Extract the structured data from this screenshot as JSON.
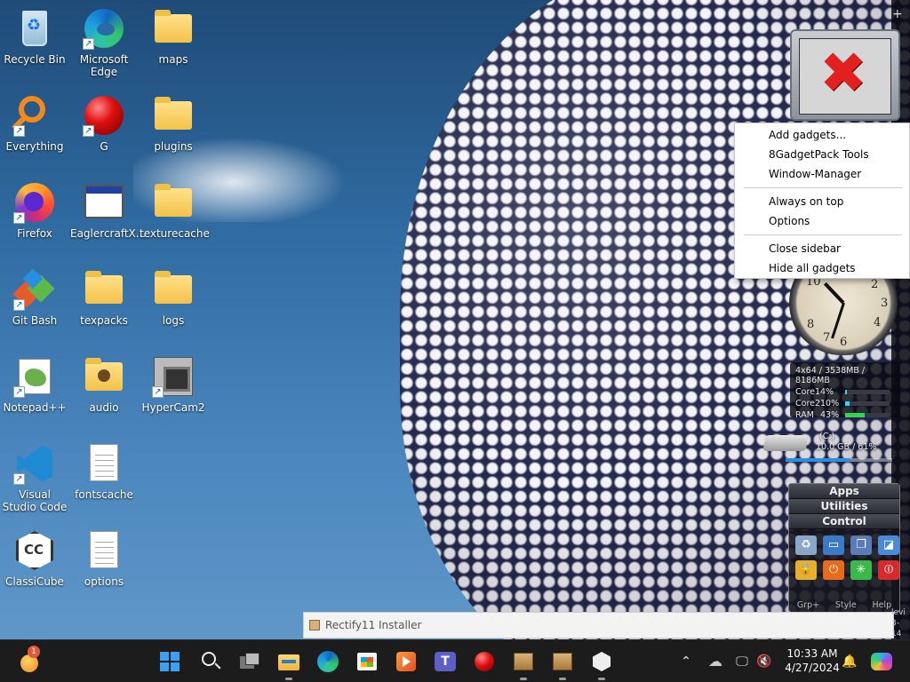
{
  "desktop": {
    "icons": [
      {
        "label": "Recycle Bin",
        "icon": "recycle-bin-icon"
      },
      {
        "label": "Microsoft Edge",
        "icon": "edge-icon"
      },
      {
        "label": "maps",
        "icon": "folder-icon"
      },
      {
        "label": "Everything",
        "icon": "magnifier-icon"
      },
      {
        "label": "G",
        "icon": "red-ball-icon"
      },
      {
        "label": "plugins",
        "icon": "folder-icon"
      },
      {
        "label": "Firefox",
        "icon": "firefox-icon"
      },
      {
        "label": "EaglercraftX...",
        "icon": "window-icon"
      },
      {
        "label": "texturecache",
        "icon": "folder-icon"
      },
      {
        "label": "Git Bash",
        "icon": "git-bash-icon"
      },
      {
        "label": "texpacks",
        "icon": "folder-icon"
      },
      {
        "label": "logs",
        "icon": "folder-icon"
      },
      {
        "label": "Notepad++",
        "icon": "notepad-plus-plus-icon"
      },
      {
        "label": "audio",
        "icon": "folder-icon"
      },
      {
        "label": "HyperCam2",
        "icon": "hypercam-icon"
      },
      {
        "label": "Visual Studio Code",
        "icon": "vscode-icon"
      },
      {
        "label": "fontscache",
        "icon": "document-icon"
      },
      {
        "label": "ClassiCube",
        "icon": "classicube-icon"
      },
      {
        "label": "options",
        "icon": "document-icon"
      }
    ]
  },
  "context_menu": {
    "items": [
      "Add gadgets...",
      "8GadgetPack Tools",
      "Window-Manager",
      "Always on top",
      "Options",
      "Close sidebar",
      "Hide all gadgets"
    ]
  },
  "clock": {
    "numbers": [
      "10",
      "2",
      "3",
      "4",
      "6",
      "7",
      "8"
    ],
    "hour": 10,
    "minute": 33
  },
  "cpu_gadget": {
    "header": "4x64 / 3538MB / 8186MB",
    "rows": [
      {
        "label": "Core1",
        "value": "4%",
        "fill": 0.04
      },
      {
        "label": "Core2",
        "value": "10%",
        "fill": 0.1
      },
      {
        "label": "RAM",
        "value": "43%",
        "fill": 0.43
      }
    ]
  },
  "drive_gadget": {
    "drive_label": "(C:)",
    "usage": "10.0 GB / 61%",
    "fill": 0.61
  },
  "launcher": {
    "tabs": [
      "Apps",
      "Utilities",
      "Control"
    ],
    "footer": [
      "Grp+",
      "Style",
      "Help"
    ],
    "buttons": [
      {
        "icon": "recycle-bin-icon",
        "color": "#8aa6c8",
        "glyph": "♻"
      },
      {
        "icon": "drive-icon",
        "color": "#3c7ac8",
        "glyph": "▭"
      },
      {
        "icon": "windows-icon",
        "color": "#5a7ab8",
        "glyph": "❐"
      },
      {
        "icon": "display-icon",
        "color": "#4a88d8",
        "glyph": "◪"
      },
      {
        "icon": "lock-icon",
        "color": "#e8b02a",
        "glyph": "🔒"
      },
      {
        "icon": "power-icon",
        "color": "#e86a1a",
        "glyph": "⏻"
      },
      {
        "icon": "restart-icon",
        "color": "#3ab84a",
        "glyph": "✳"
      },
      {
        "icon": "shutdown-icon",
        "color": "#d82a2a",
        "glyph": "⏼"
      }
    ]
  },
  "installer": {
    "title": "Rectify11 Installer"
  },
  "behind_window_text": "levi 3-14",
  "taskbar": {
    "notification_badge": "1",
    "time": "10:33 AM",
    "date": "4/27/2024",
    "pinned": [
      "start-icon",
      "search-icon",
      "task-view-icon",
      "file-explorer-icon",
      "edge-icon",
      "store-icon",
      "media-player-icon",
      "teams-icon",
      "red-ball-icon",
      "package-icon",
      "package-icon",
      "classicube-icon"
    ]
  },
  "colors": {
    "accent": "#3aa0f0",
    "taskbar": "#1c1c1c",
    "menu_bg": "#ffffff"
  }
}
